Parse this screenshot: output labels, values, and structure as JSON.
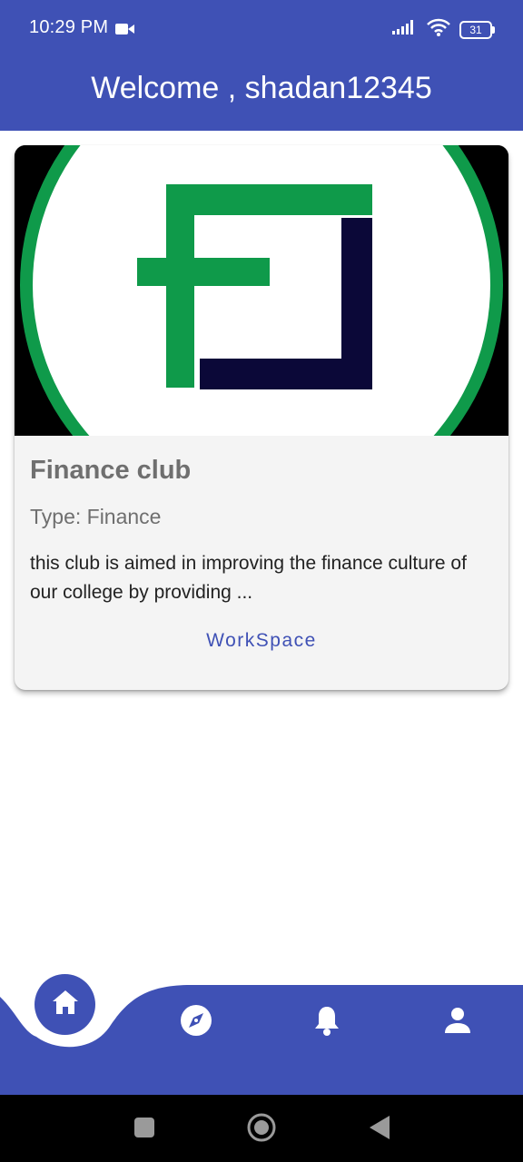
{
  "status_bar": {
    "time": "10:29 PM",
    "battery": "31"
  },
  "header": {
    "title": "Welcome , shadan12345"
  },
  "club_card": {
    "title": "Finance club",
    "type": "Type: Finance",
    "description": "this club is aimed in improving the finance culture of our college by providing ...",
    "action_label": "WorkSpace"
  },
  "bottom_nav": {
    "items": [
      "home-icon",
      "compass-icon",
      "bell-icon",
      "person-icon"
    ],
    "active": "home-icon"
  },
  "colors": {
    "primary": "#3f51b5",
    "logo_green": "#0f9a4a",
    "logo_navy": "#0b0838"
  }
}
